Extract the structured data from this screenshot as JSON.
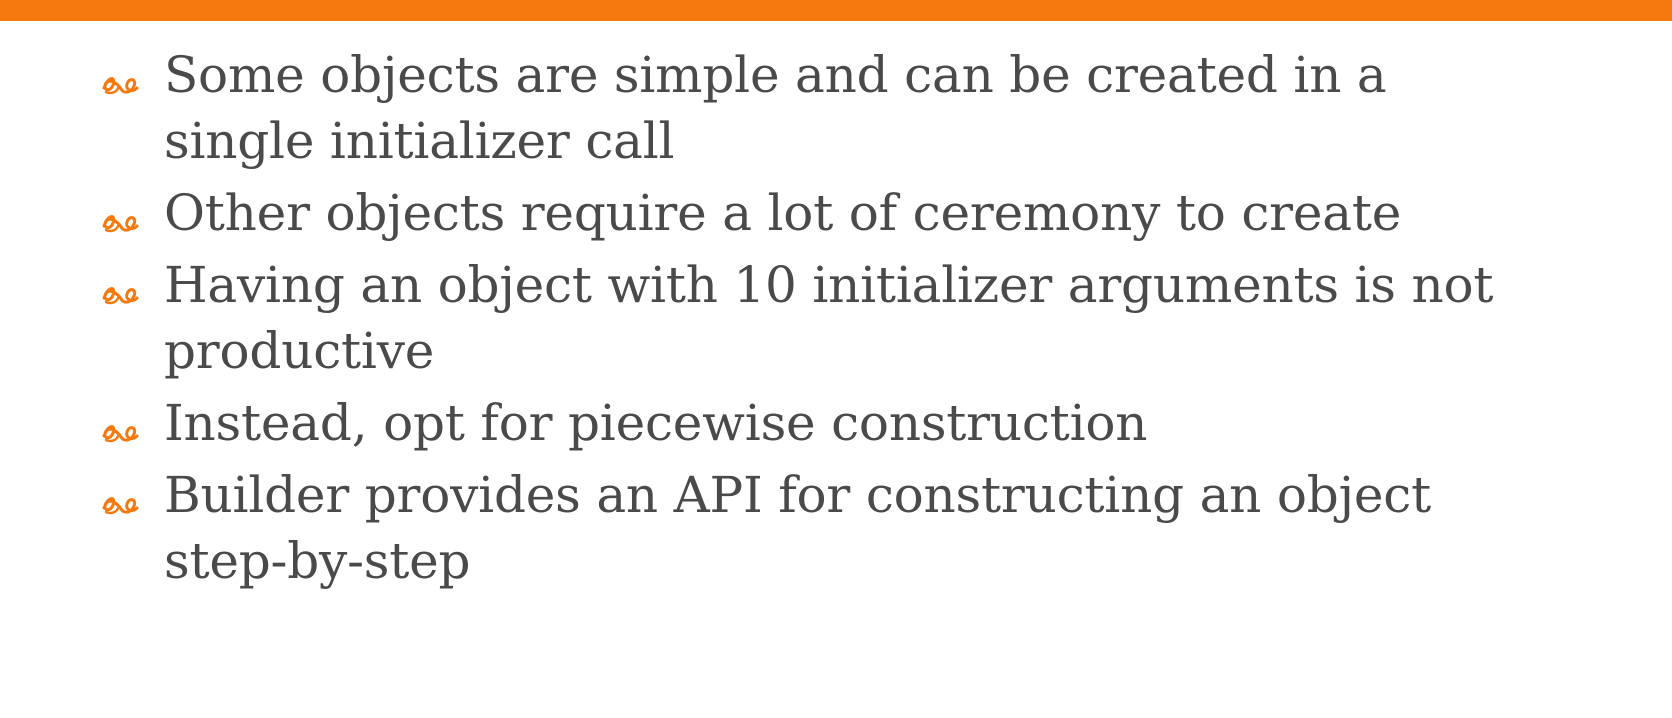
{
  "slide": {
    "accent_color": "#f5790f",
    "bullets": [
      {
        "icon": "ornament-icon",
        "text": "Some objects are simple and can be created in a single initializer call"
      },
      {
        "icon": "ornament-icon",
        "text": "Other objects require a lot of ceremony to create"
      },
      {
        "icon": "ornament-icon",
        "text": "Having an object with 10 initializer arguments is not productive"
      },
      {
        "icon": "ornament-icon",
        "text": "Instead, opt for piecewise construction"
      },
      {
        "icon": "ornament-icon",
        "text": "Builder provides an API for constructing an object step-by-step"
      }
    ]
  }
}
